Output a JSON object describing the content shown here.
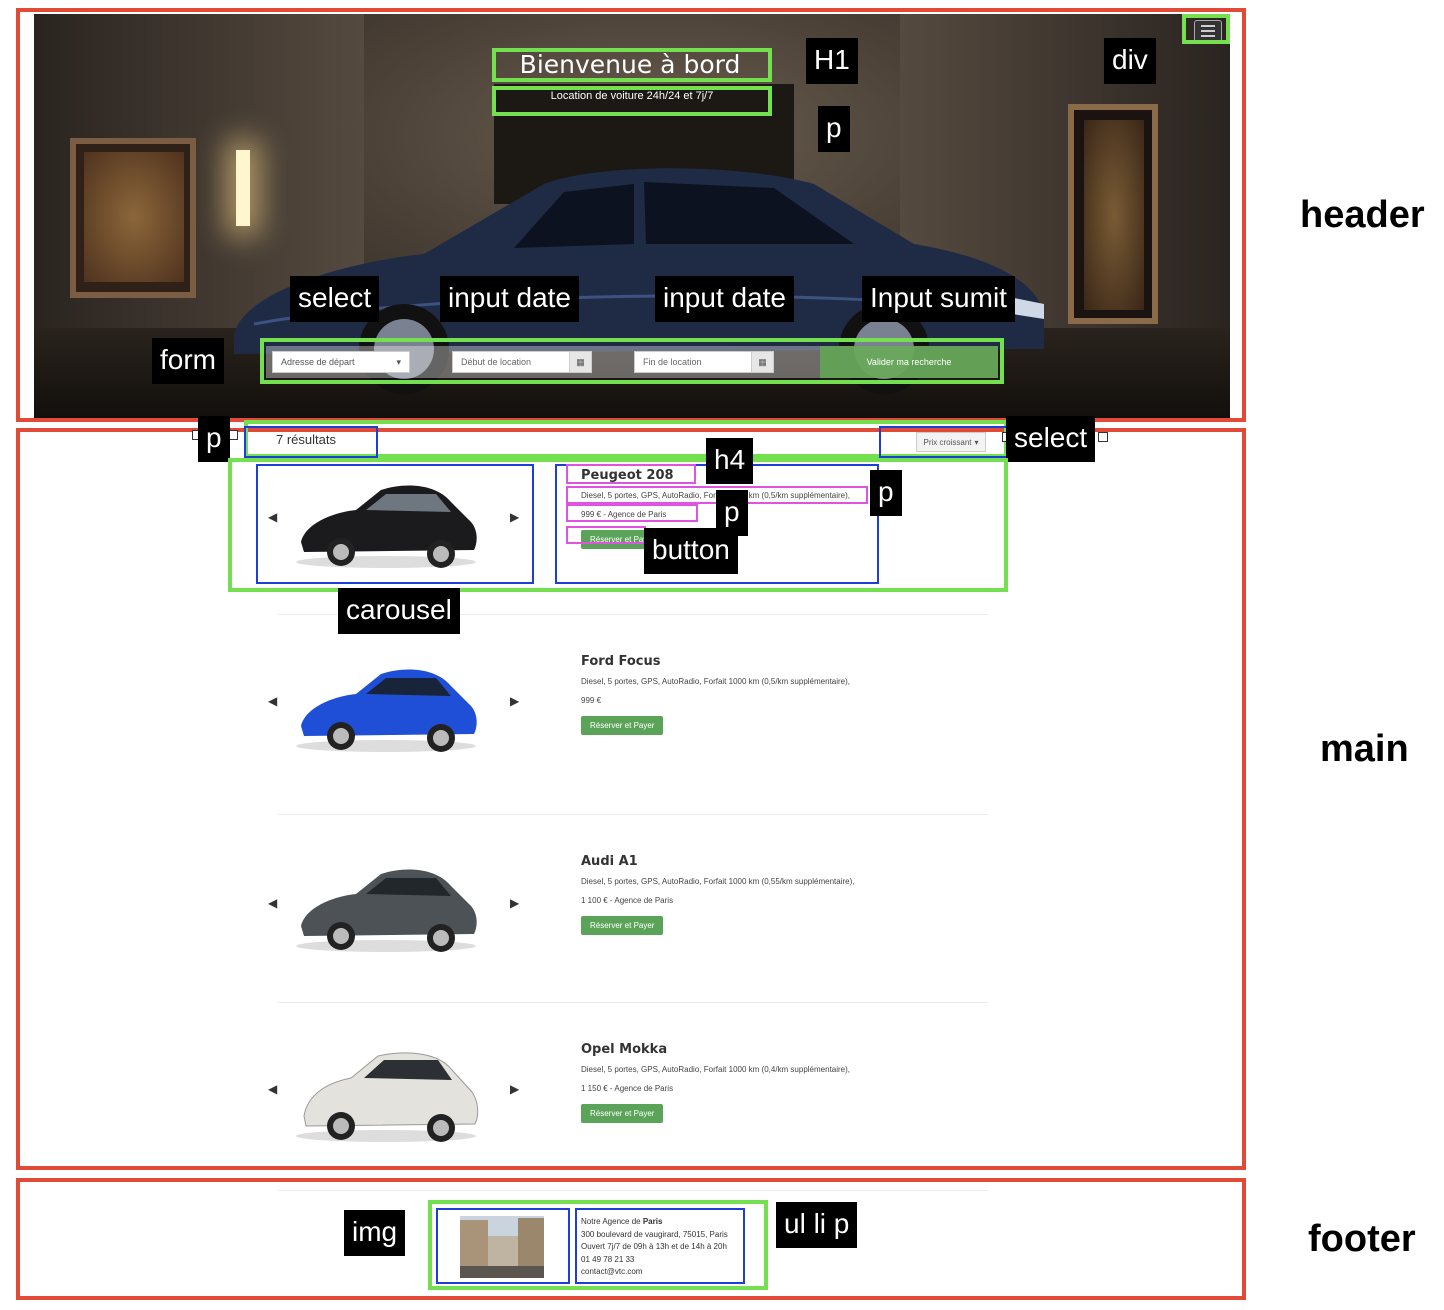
{
  "header": {
    "title": "Bienvenue à bord",
    "subtitle": "Location de voiture 24h/24 et 7j/7",
    "search": {
      "start_placeholder": "Adresse de départ",
      "date_start_placeholder": "Début de location",
      "date_end_placeholder": "Fin de location",
      "submit_label": "Valider ma recherche"
    }
  },
  "results": {
    "count_label": "7 résultats",
    "sort_label": "Prix croissant",
    "cars": [
      {
        "name": "Peugeot 208",
        "desc": "Diesel, 5 portes, GPS, AutoRadio, Forfait 1000 km (0,5/km supplémentaire),",
        "price": "999 € - Agence de Paris",
        "button": "Réserver et Payer",
        "color": "#1b1b1d"
      },
      {
        "name": "Ford Focus",
        "desc": "Diesel, 5 portes, GPS, AutoRadio, Forfait 1000 km (0,5/km supplémentaire),",
        "price": "999 €",
        "button": "Réserver et Payer",
        "color": "#1f4fd6"
      },
      {
        "name": "Audi A1",
        "desc": "Diesel, 5 portes, GPS, AutoRadio, Forfait 1000 km (0,55/km supplémentaire),",
        "price": "1 100 € - Agence de Paris",
        "button": "Réserver et Payer",
        "color": "#4c5256"
      },
      {
        "name": "Opel Mokka",
        "desc": "Diesel, 5 portes, GPS, AutoRadio, Forfait 1000 km (0,4/km supplémentaire),",
        "price": "1 150 € - Agence de Paris",
        "button": "Réserver et Payer",
        "color": "#e4e2dd"
      }
    ]
  },
  "footer": {
    "agency_prefix": "Notre Agence de",
    "agency_city": "Paris",
    "address": "300 boulevard de vaugirard, 75015, Paris",
    "hours": "Ouvert 7j/7 de 09h à 13h et de 14h à 20h",
    "phone": "01 49 78 21 33",
    "email": "contact@vtc.com"
  },
  "annotations": {
    "header": "header",
    "main": "main",
    "footer": "footer",
    "h1": "H1",
    "p": "p",
    "div": "div",
    "select": "select",
    "input_date": "input date",
    "input_submit": "Input sumit",
    "form": "form",
    "h4": "h4",
    "button": "button",
    "carousel": "carousel",
    "img": "img",
    "ul_li_p": "ul li p"
  },
  "colors": {
    "annotation_red": "#e04a36",
    "annotation_green": "#74e04f",
    "annotation_blue": "#1c3fd8",
    "annotation_pink": "#e052e0",
    "button_green": "#5ca35a"
  }
}
